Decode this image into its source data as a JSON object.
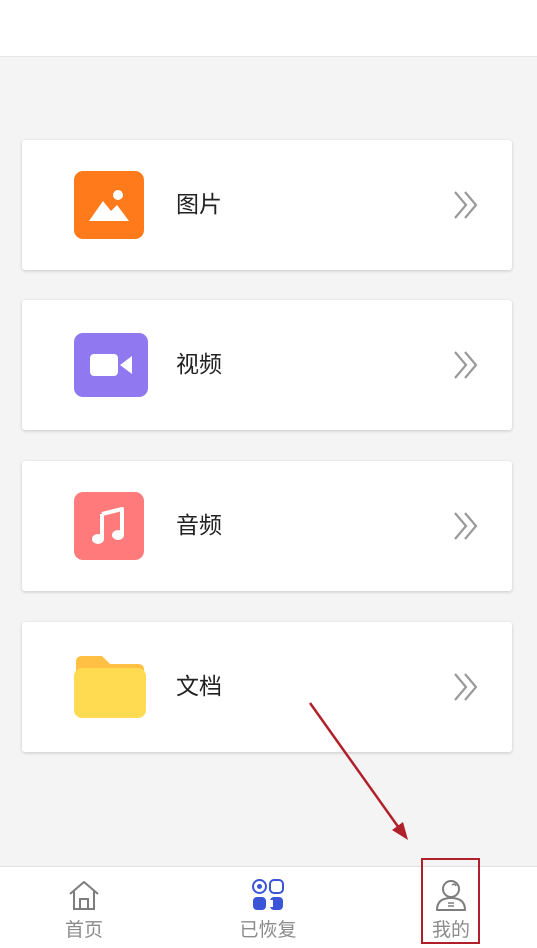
{
  "categories": [
    {
      "label": "图片",
      "icon": "image-icon",
      "color": "#ff7a1a"
    },
    {
      "label": "视频",
      "icon": "video-camera-icon",
      "color": "#8f78f0"
    },
    {
      "label": "音频",
      "icon": "music-note-icon",
      "color": "#ff7b7b"
    },
    {
      "label": "文档",
      "icon": "folder-icon",
      "color": "#ffd84f"
    }
  ],
  "tabbar": {
    "home_label": "首页",
    "recovered_label": "已恢复",
    "mine_label": "我的"
  },
  "colors": {
    "tab_inactive": "#8b8b8b",
    "recovered_icon": "#3a55d8",
    "annotation": "#b0202a"
  }
}
